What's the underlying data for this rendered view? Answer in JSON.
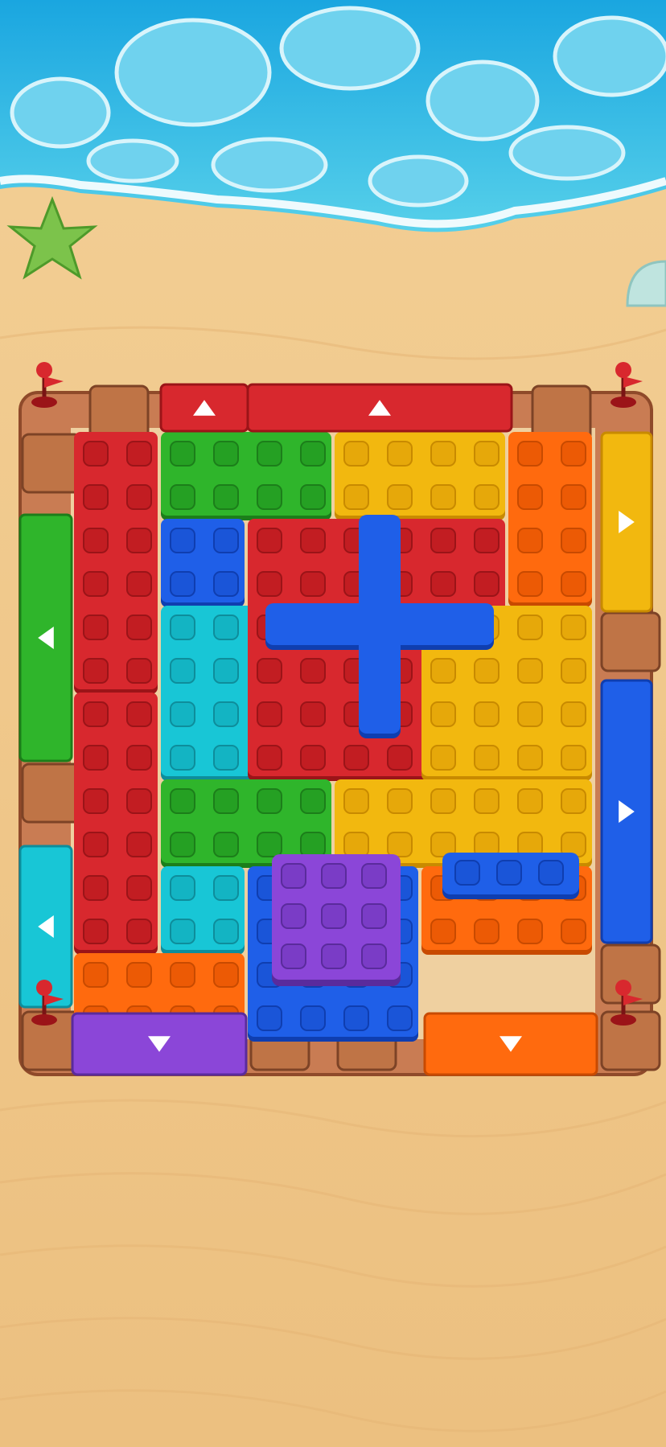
{
  "game": {
    "name": "block-escape-puzzle",
    "board": {
      "columns": 6,
      "rows": 7
    },
    "colors": {
      "red": "#d8282e",
      "green": "#2fb52b",
      "yellow": "#f2b80f",
      "orange": "#ff6a0e",
      "blue": "#1f5fe8",
      "cyan": "#18c6d6",
      "purple": "#8b46d8",
      "sand": "#efc98d",
      "water": "#27b3e0",
      "crate": "#b86d43"
    },
    "blocks": [
      {
        "id": "red-left-upper",
        "color": "red",
        "col": 0,
        "row": 0,
        "w": 1,
        "h": 3
      },
      {
        "id": "red-left-lower",
        "color": "red",
        "col": 0,
        "row": 3,
        "w": 1,
        "h": 3
      },
      {
        "id": "green-top",
        "color": "green",
        "col": 1,
        "row": 0,
        "w": 2,
        "h": 1
      },
      {
        "id": "yellow-top",
        "color": "yellow",
        "col": 3,
        "row": 0,
        "w": 2,
        "h": 1
      },
      {
        "id": "orange-top-right",
        "color": "orange",
        "col": 5,
        "row": 0,
        "w": 1,
        "h": 2
      },
      {
        "id": "blue-small",
        "color": "blue",
        "col": 1,
        "row": 1,
        "w": 1,
        "h": 1
      },
      {
        "id": "cyan-L",
        "color": "cyan",
        "col": 1,
        "row": 2,
        "w": 2,
        "h": 2
      },
      {
        "id": "red-cross",
        "color": "red",
        "col": 2,
        "row": 1,
        "w": 3,
        "h": 3
      },
      {
        "id": "yellow-right",
        "color": "yellow",
        "col": 4,
        "row": 2,
        "w": 2,
        "h": 2
      },
      {
        "id": "green-mid",
        "color": "green",
        "col": 1,
        "row": 4,
        "w": 2,
        "h": 1
      },
      {
        "id": "yellow-mid",
        "color": "yellow",
        "col": 3,
        "row": 4,
        "w": 3,
        "h": 1
      },
      {
        "id": "cyan-small",
        "color": "cyan",
        "col": 1,
        "row": 5,
        "w": 1,
        "h": 1
      },
      {
        "id": "blue-big",
        "color": "blue",
        "col": 2,
        "row": 5,
        "w": 2,
        "h": 2
      },
      {
        "id": "orange-right",
        "color": "orange",
        "col": 4,
        "row": 5,
        "w": 2,
        "h": 1
      },
      {
        "id": "orange-bottom",
        "color": "orange",
        "col": 0,
        "row": 6,
        "w": 2,
        "h": 1
      }
    ],
    "overlays": [
      {
        "id": "blue-cross",
        "color": "blue"
      },
      {
        "id": "purple-square",
        "color": "purple"
      },
      {
        "id": "blue-bar",
        "color": "blue"
      }
    ],
    "exits": [
      {
        "id": "red-exit-top-small",
        "color": "red",
        "direction": "up"
      },
      {
        "id": "red-exit-top-wide",
        "color": "red",
        "direction": "up"
      },
      {
        "id": "yellow-exit-right",
        "color": "yellow",
        "direction": "right"
      },
      {
        "id": "blue-exit-right",
        "color": "blue",
        "direction": "right"
      },
      {
        "id": "green-exit-left",
        "color": "green",
        "direction": "left"
      },
      {
        "id": "cyan-exit-left",
        "color": "cyan",
        "direction": "left"
      },
      {
        "id": "purple-exit-bottom",
        "color": "purple",
        "direction": "down"
      },
      {
        "id": "orange-exit-bottom",
        "color": "orange",
        "direction": "down"
      }
    ]
  }
}
